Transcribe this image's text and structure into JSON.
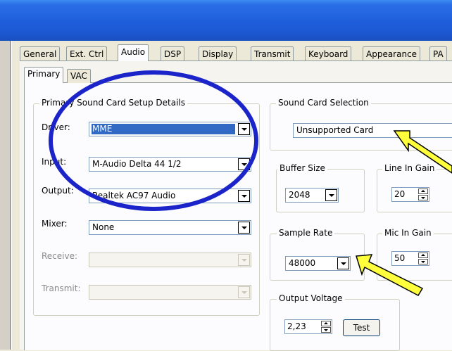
{
  "colors": {
    "titlebar": "#1f5fdc",
    "selection": "#316ac5",
    "annotation_circle": "#1a24c8",
    "annotation_arrow": "#ffff3b"
  },
  "tabs": [
    "General",
    "Ext. Ctrl",
    "Audio",
    "DSP",
    "Display",
    "Transmit",
    "Keyboard",
    "Appearance",
    "PA"
  ],
  "active_tab": "Audio",
  "subtabs": [
    "Primary",
    "VAC"
  ],
  "active_subtab": "Primary",
  "primary_group": {
    "title": "Primary Sound Card Setup Details",
    "driver": {
      "label": "Driver:",
      "value": "MME"
    },
    "input": {
      "label": "Input:",
      "value": "M-Audio Delta 44 1/2"
    },
    "output": {
      "label": "Output:",
      "value": "Realtek AC97 Audio"
    },
    "mixer": {
      "label": "Mixer:",
      "value": "None"
    },
    "receive": {
      "label": "Receive:",
      "value": ""
    },
    "transmit": {
      "label": "Transmit:",
      "value": ""
    }
  },
  "sound_card": {
    "title": "Sound Card Selection",
    "value": "Unsupported Card"
  },
  "buffer_size": {
    "title": "Buffer Size",
    "value": "2048"
  },
  "line_in_gain": {
    "title": "Line In Gain",
    "value": "20"
  },
  "sample_rate": {
    "title": "Sample Rate",
    "value": "48000"
  },
  "mic_in_gain": {
    "title": "Mic In Gain",
    "value": "50"
  },
  "output_voltage": {
    "title": "Output Voltage",
    "value": "2,23",
    "test_label": "Test"
  },
  "annotation_icons": [
    "ellipse-highlight",
    "arrow-pointer-icon"
  ]
}
